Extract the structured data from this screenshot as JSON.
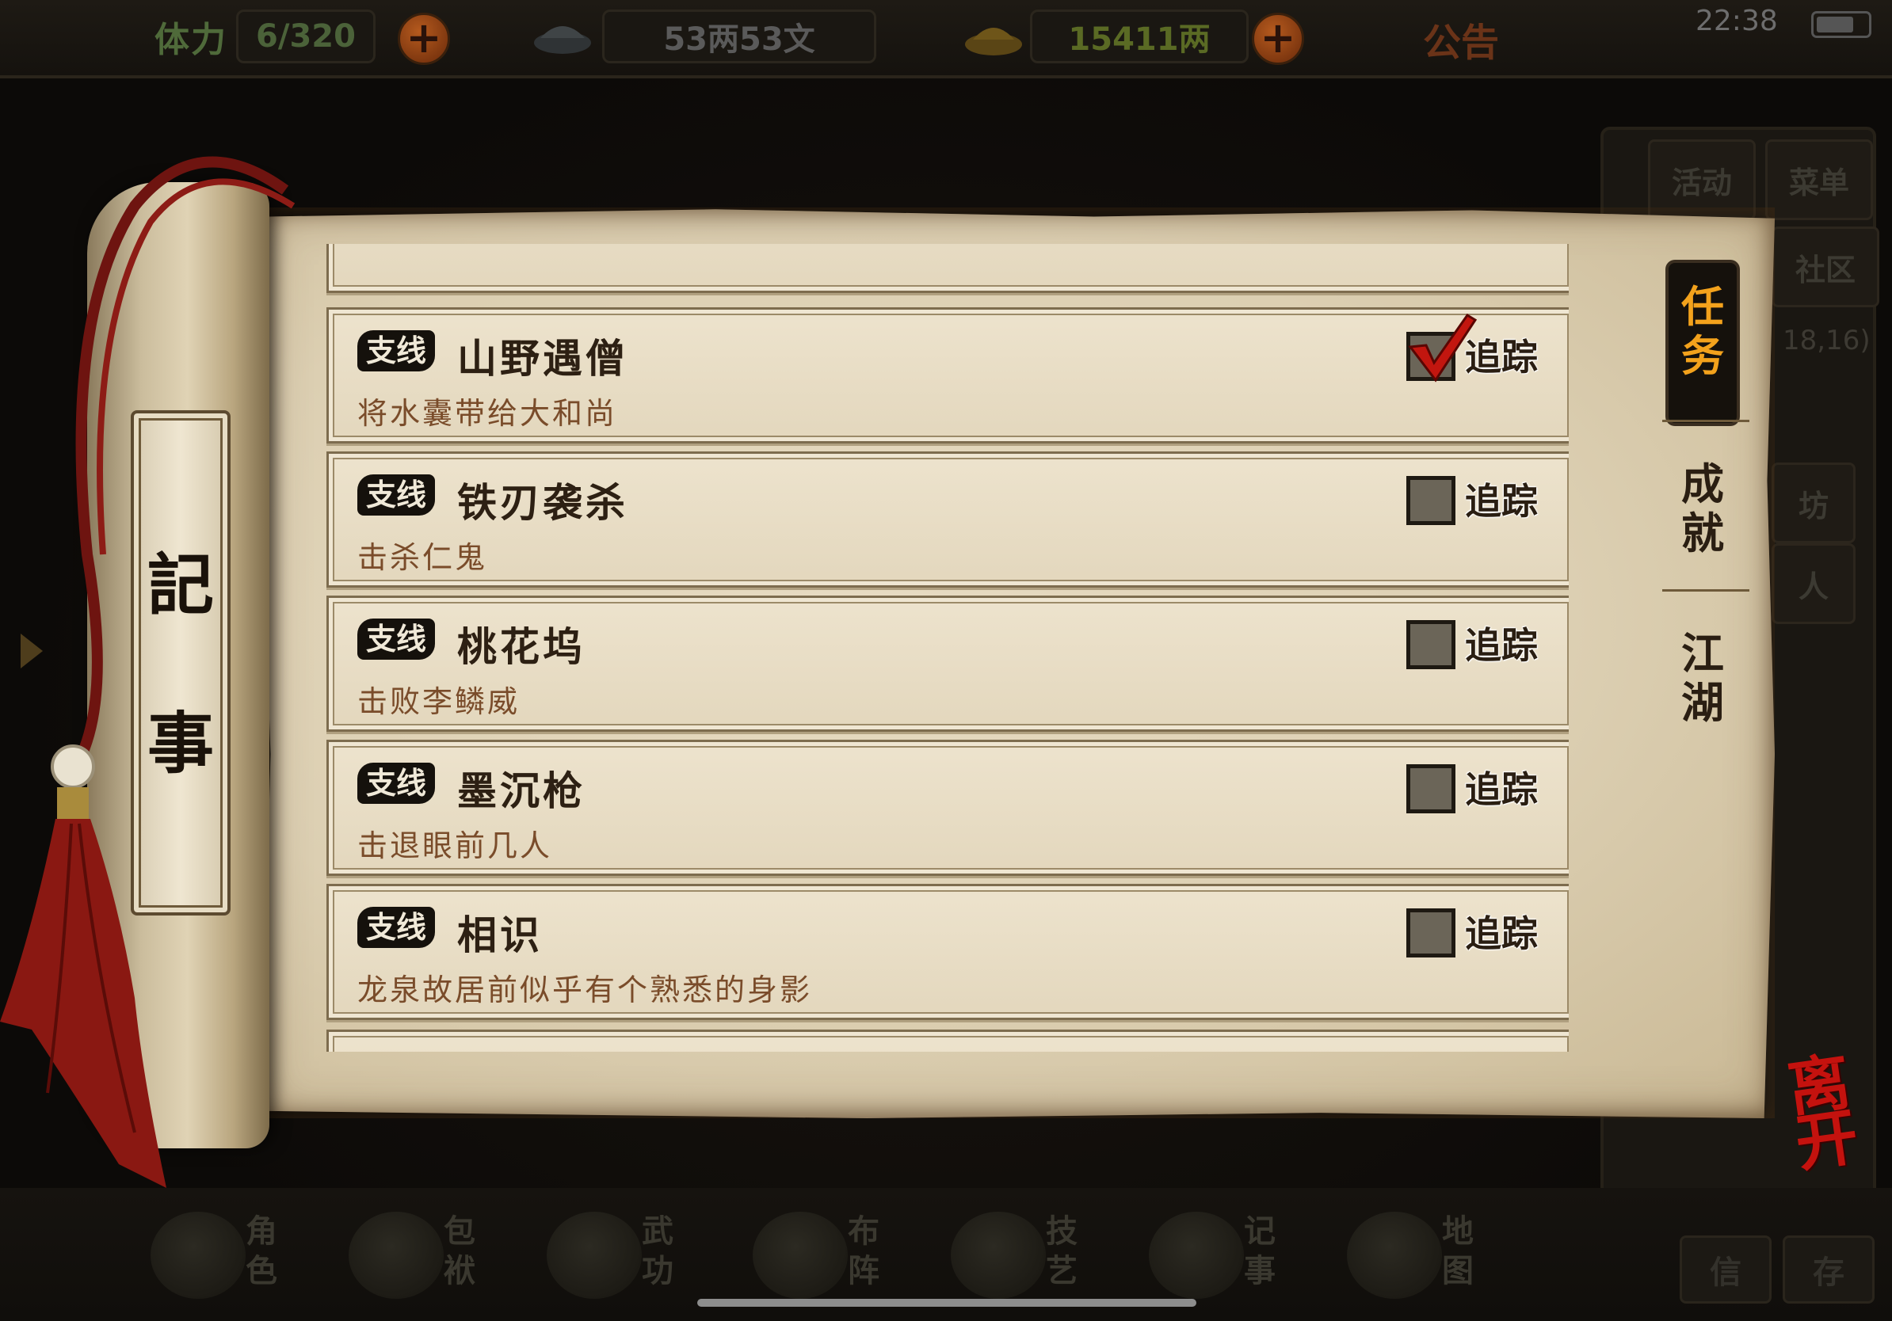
{
  "status_bar": {
    "stamina_label": "体力",
    "stamina_value": "6/320",
    "silver_value": "53两53文",
    "gold_value": "15411两",
    "notice_label": "公告",
    "clock": "22:38"
  },
  "side_buttons": {
    "activity": "活动",
    "menu": "菜单",
    "community": "社区",
    "coords": "18,16)",
    "shop": "坊",
    "person": "人"
  },
  "scroll": {
    "roller_char_1": "記",
    "roller_char_2": "事"
  },
  "quests": [
    {
      "tag": "支线",
      "title": "山野遇僧",
      "desc": "将水囊带给大和尚",
      "tracked": true,
      "track_label": "追踪"
    },
    {
      "tag": "支线",
      "title": "铁刃袭杀",
      "desc": "击杀仁鬼",
      "tracked": false,
      "track_label": "追踪"
    },
    {
      "tag": "支线",
      "title": "桃花坞",
      "desc": "击败李鳞威",
      "tracked": false,
      "track_label": "追踪"
    },
    {
      "tag": "支线",
      "title": "墨沉枪",
      "desc": "击退眼前几人",
      "tracked": false,
      "track_label": "追踪"
    },
    {
      "tag": "支线",
      "title": "相识",
      "desc": "龙泉故居前似乎有个熟悉的身影",
      "tracked": false,
      "track_label": "追踪"
    }
  ],
  "tabs": {
    "quests_1": "任",
    "quests_2": "务",
    "achievements_1": "成",
    "achievements_2": "就",
    "jianghu_1": "江",
    "jianghu_2": "湖"
  },
  "exit_label_1": "离",
  "exit_label_2": "开",
  "bottom_nav": [
    {
      "label_1": "角",
      "label_2": "色"
    },
    {
      "label_1": "包",
      "label_2": "袱"
    },
    {
      "label_1": "武",
      "label_2": "功"
    },
    {
      "label_1": "布",
      "label_2": "阵"
    },
    {
      "label_1": "技",
      "label_2": "艺"
    },
    {
      "label_1": "记",
      "label_2": "事"
    },
    {
      "label_1": "地",
      "label_2": "图"
    }
  ],
  "corner_buttons": {
    "mail": "信",
    "save": "存"
  },
  "colors": {
    "active_tab_text": "#f3a21c",
    "exit_red": "#c4120e",
    "quest_desc": "#7a4c2a"
  }
}
